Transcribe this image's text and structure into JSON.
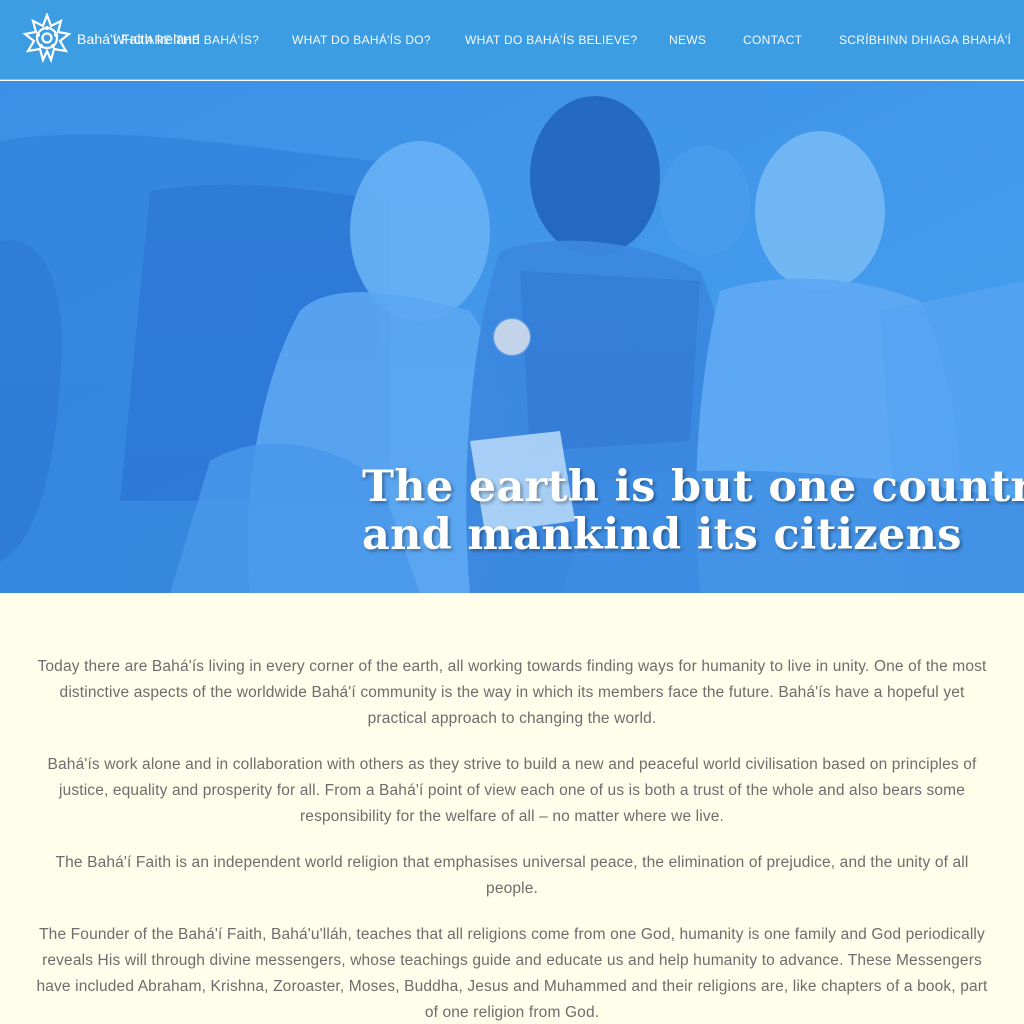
{
  "header": {
    "site_title": "Bahá'í Faith Ireland",
    "logo_icon": "nine-pointed-star-icon",
    "background_color": "#3d9de3"
  },
  "nav": {
    "items": [
      {
        "label": "WHO ARE THE BAHÁ'ÍS?"
      },
      {
        "label": "WHAT DO BAHÁ'ÍS DO?"
      },
      {
        "label": "WHAT DO BAHÁ'ÍS BELIEVE?"
      },
      {
        "label": "NEWS"
      },
      {
        "label": "CONTACT"
      },
      {
        "label": "SCRÍBHINN DHIAGA BHAHÁ'Í"
      }
    ]
  },
  "hero": {
    "quote_line1": "The earth is but one country",
    "quote_line2": "and mankind its citizens",
    "tint_color": "#3f96e8",
    "slider_current": 1
  },
  "content": {
    "paragraphs": [
      "Today there are Bahá'ís living in every corner of the earth, all working towards finding ways for humanity to live in unity. One of the most distinctive aspects of the worldwide Bahá'í community is the way in which its members face the future. Bahá'ís have a hopeful yet practical approach to changing the world.",
      "Bahá'ís work alone and in collaboration with others as they strive to build a new and peaceful world civilisation based on principles of justice, equality and prosperity for all. From a Bahá'í point of view each one of us is both a trust of the whole and also bears some responsibility for the welfare of all – no matter where we live.",
      "The Bahá'í Faith is an independent world religion that emphasises universal peace, the elimination of prejudice, and the unity of all people.",
      "The Founder of the Bahá'í Faith, Bahá'u'lláh, teaches that all religions come from one God, humanity is one family and God periodically reveals His will through divine messengers, whose teachings guide and educate us and help humanity to advance. These Messengers have included Abraham, Krishna, Zoroaster, Moses, Buddha, Jesus and Muhammed and their religions are, like chapters of a book, part of one religion from God."
    ],
    "background_color": "#fefeea"
  }
}
